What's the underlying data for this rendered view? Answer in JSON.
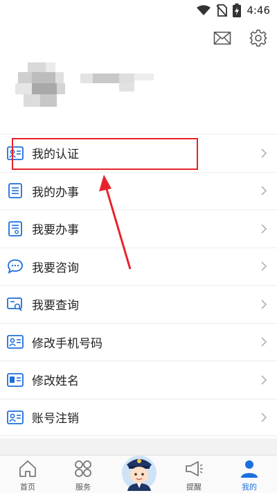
{
  "status_bar": {
    "time": "4:46",
    "icons": [
      "wifi-icon",
      "no-sim-icon",
      "battery-charging-icon"
    ]
  },
  "header": {
    "icons": [
      "mail-icon",
      "settings-gear-icon"
    ]
  },
  "menu": {
    "items": [
      {
        "label": "我的认证",
        "icon": "id-card-icon"
      },
      {
        "label": "我的办事",
        "icon": "list-document-icon"
      },
      {
        "label": "我要办事",
        "icon": "form-document-icon"
      },
      {
        "label": "我要咨询",
        "icon": "chat-bubble-icon"
      },
      {
        "label": "我要查询",
        "icon": "search-card-icon"
      },
      {
        "label": "修改手机号码",
        "icon": "id-card-icon"
      },
      {
        "label": "修改姓名",
        "icon": "name-card-icon"
      },
      {
        "label": "账号注销",
        "icon": "id-card-icon"
      }
    ]
  },
  "bottom_nav": {
    "tabs": [
      {
        "label": "首页",
        "icon": "home-icon",
        "active": false
      },
      {
        "label": "服务",
        "icon": "grid-icon",
        "active": false
      },
      {
        "label": "",
        "icon": "police-avatar-icon",
        "active": false
      },
      {
        "label": "提醒",
        "icon": "megaphone-icon",
        "active": false
      },
      {
        "label": "我的",
        "icon": "person-icon",
        "active": true
      }
    ]
  },
  "colors": {
    "accent": "#1c6fde",
    "annotation": "#e8222a",
    "divider": "#ececec"
  }
}
